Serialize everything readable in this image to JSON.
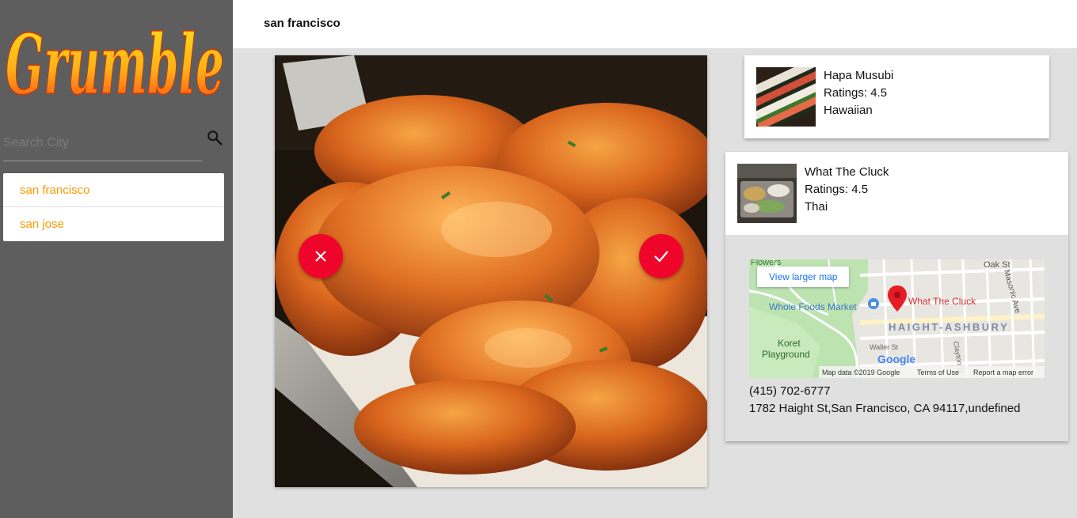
{
  "app": {
    "logo_text": "Grumble"
  },
  "search": {
    "placeholder": "Search City",
    "value": ""
  },
  "cities": [
    {
      "label": "san francisco"
    },
    {
      "label": "san jose"
    }
  ],
  "header": {
    "title": "san francisco"
  },
  "restaurants": [
    {
      "name": "Hapa Musubi",
      "ratings": "Ratings: 4.5",
      "cuisine": "Hawaiian"
    },
    {
      "name": "What The Cluck",
      "ratings": "Ratings: 4.5",
      "cuisine": "Thai",
      "phone": "(415) 702-6777",
      "address": "1782 Haight St,San Francisco, CA 94117,undefined"
    }
  ],
  "map": {
    "view_larger": "View larger map",
    "labels": {
      "flowers": "Flowers",
      "oak": "Oak St",
      "masonic": "Masonic Ave",
      "whole_foods": "Whole Foods Market",
      "pin": "What The Cluck",
      "haight": "HAIGHT-ASHBURY",
      "koret1": "Koret",
      "koret2": "Playground",
      "waller": "Waller St",
      "clayton": "Clayton St",
      "google": "Google",
      "map_data": "Map data ©2019 Google",
      "terms": "Terms of Use",
      "report": "Report a map error"
    }
  },
  "colors": {
    "sidebar": "#5e5e5e",
    "accent": "#ff9800",
    "action_red": "#f0052a",
    "map_link": "#1a73e8"
  }
}
